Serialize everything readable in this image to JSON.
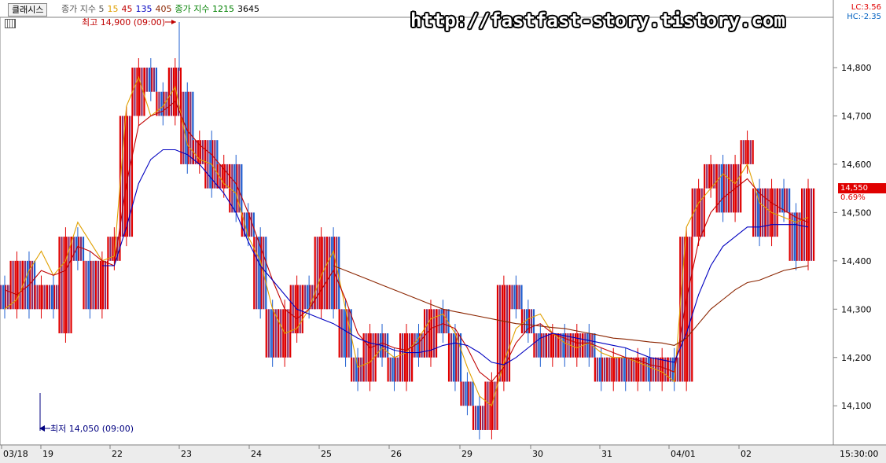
{
  "toolbar": {
    "button_label": "클래시스",
    "legend": [
      {
        "text": "종가 지수 5",
        "color": "#555555"
      },
      {
        "text": "15",
        "color": "#e0a000"
      },
      {
        "text": "45",
        "color": "#c00000"
      },
      {
        "text": "135",
        "color": "#0000c0"
      },
      {
        "text": "405",
        "color": "#8b2500"
      },
      {
        "text": "종가 지수 1215",
        "color": "#008000"
      },
      {
        "text": "3645",
        "color": "#000000"
      }
    ]
  },
  "watermark": "http://fastfast-story.tistory.com",
  "stats": {
    "lc": "LC:3.56",
    "hc": "HC:-2.35",
    "lc_color": "#e00000",
    "hc_color": "#0060c0"
  },
  "current_price": {
    "label": "14,550",
    "change": "0.69%",
    "color": "#e00000"
  },
  "annotations": {
    "high": "최고 14,900 (09:00)",
    "low": "최저 14,050 (09:00)",
    "high_color": "#c00000",
    "low_color": "#000080"
  },
  "time_label": "15:30:00",
  "chart_data": {
    "type": "bar",
    "title": "",
    "ylim": [
      14050,
      14900
    ],
    "y_ticks": [
      {
        "value": 14800,
        "label": "14,800"
      },
      {
        "value": 14700,
        "label": "14,700"
      },
      {
        "value": 14600,
        "label": "14,600"
      },
      {
        "value": 14500,
        "label": "14,500"
      },
      {
        "value": 14400,
        "label": "14,400"
      },
      {
        "value": 14300,
        "label": "14,300"
      },
      {
        "value": 14200,
        "label": "14,200"
      },
      {
        "value": 14100,
        "label": "14,100"
      }
    ],
    "x_labels": [
      "03/18",
      "19",
      "22",
      "23",
      "24",
      "25",
      "26",
      "29",
      "30",
      "31",
      "04/01",
      "02"
    ],
    "grid": false,
    "colors": {
      "up": "#e00000",
      "down": "#1f5fd0",
      "mixed": "#8a2c6a"
    },
    "series": [
      {
        "name": "5",
        "color": "#e0a000",
        "values": [
          14300,
          14320,
          14380,
          14420,
          14370,
          14400,
          14480,
          14440,
          14400,
          14410,
          14720,
          14780,
          14700,
          14720,
          14760,
          14640,
          14610,
          14600,
          14560,
          14540,
          14450,
          14400,
          14300,
          14250,
          14260,
          14300,
          14370,
          14420,
          14300,
          14180,
          14190,
          14220,
          14200,
          14210,
          14240,
          14280,
          14290,
          14250,
          14180,
          14120,
          14100,
          14190,
          14260,
          14280,
          14290,
          14250,
          14230,
          14220,
          14230,
          14210,
          14200,
          14200,
          14190,
          14180,
          14170,
          14150,
          14470,
          14520,
          14550,
          14580,
          14560,
          14600,
          14520,
          14500,
          14490,
          14480,
          14490
        ]
      },
      {
        "name": "45",
        "color": "#c00000",
        "values": [
          14340,
          14330,
          14350,
          14380,
          14370,
          14380,
          14430,
          14420,
          14400,
          14390,
          14560,
          14680,
          14700,
          14710,
          14730,
          14670,
          14640,
          14620,
          14590,
          14560,
          14500,
          14430,
          14360,
          14300,
          14280,
          14300,
          14340,
          14380,
          14320,
          14250,
          14220,
          14230,
          14220,
          14215,
          14230,
          14260,
          14270,
          14260,
          14220,
          14170,
          14150,
          14180,
          14230,
          14260,
          14270,
          14250,
          14240,
          14230,
          14230,
          14220,
          14210,
          14200,
          14195,
          14185,
          14180,
          14170,
          14320,
          14440,
          14500,
          14530,
          14550,
          14570,
          14540,
          14520,
          14505,
          14490,
          14480
        ]
      },
      {
        "name": "135",
        "color": "#0000c0",
        "values": [
          null,
          null,
          null,
          null,
          null,
          null,
          null,
          null,
          14390,
          14390,
          14470,
          14560,
          14610,
          14630,
          14630,
          14620,
          14600,
          14570,
          14540,
          14500,
          14440,
          14390,
          14360,
          14330,
          14300,
          14290,
          14280,
          14270,
          14255,
          14240,
          14230,
          14225,
          14215,
          14210,
          14210,
          14215,
          14225,
          14230,
          14225,
          14210,
          14190,
          14185,
          14200,
          14220,
          14240,
          14250,
          14245,
          14240,
          14235,
          14230,
          14225,
          14220,
          14210,
          14200,
          14195,
          14190,
          14250,
          14330,
          14390,
          14430,
          14450,
          14470,
          14470,
          14475,
          14475,
          14475,
          14470
        ]
      },
      {
        "name": "405",
        "color": "#8b2500",
        "values": [
          null,
          null,
          null,
          null,
          null,
          null,
          null,
          null,
          null,
          null,
          null,
          null,
          null,
          null,
          null,
          null,
          null,
          null,
          null,
          null,
          null,
          null,
          null,
          null,
          null,
          null,
          null,
          14390,
          14380,
          14370,
          14360,
          14350,
          14340,
          14330,
          14320,
          14310,
          14300,
          14295,
          14290,
          14285,
          14280,
          14275,
          14270,
          14268,
          14265,
          14262,
          14260,
          14255,
          14250,
          14245,
          14240,
          14238,
          14235,
          14232,
          14230,
          14225,
          14240,
          14270,
          14300,
          14320,
          14340,
          14355,
          14360,
          14370,
          14380,
          14385,
          14390
        ]
      }
    ],
    "candles": [
      {
        "o": 14350,
        "c": 14300
      },
      {
        "o": 14300,
        "c": 14400
      },
      {
        "o": 14400,
        "c": 14300
      },
      {
        "o": 14300,
        "c": 14350
      },
      {
        "o": 14350,
        "c": 14300
      },
      {
        "o": 14250,
        "c": 14450
      },
      {
        "o": 14450,
        "c": 14400
      },
      {
        "o": 14400,
        "c": 14300
      },
      {
        "o": 14300,
        "c": 14400
      },
      {
        "o": 14400,
        "c": 14450
      },
      {
        "o": 14450,
        "c": 14700
      },
      {
        "o": 14700,
        "c": 14800
      },
      {
        "o": 14800,
        "c": 14750
      },
      {
        "o": 14750,
        "c": 14700
      },
      {
        "o": 14700,
        "c": 14800
      },
      {
        "o": 14750,
        "c": 14600
      },
      {
        "o": 14600,
        "c": 14650
      },
      {
        "o": 14650,
        "c": 14550
      },
      {
        "o": 14550,
        "c": 14600
      },
      {
        "o": 14600,
        "c": 14500
      },
      {
        "o": 14500,
        "c": 14450
      },
      {
        "o": 14450,
        "c": 14300
      },
      {
        "o": 14300,
        "c": 14200
      },
      {
        "o": 14200,
        "c": 14300
      },
      {
        "o": 14250,
        "c": 14350
      },
      {
        "o": 14350,
        "c": 14300
      },
      {
        "o": 14300,
        "c": 14450
      },
      {
        "o": 14450,
        "c": 14300
      },
      {
        "o": 14300,
        "c": 14200
      },
      {
        "o": 14200,
        "c": 14150
      },
      {
        "o": 14150,
        "c": 14250
      },
      {
        "o": 14250,
        "c": 14200
      },
      {
        "o": 14200,
        "c": 14150
      },
      {
        "o": 14150,
        "c": 14250
      },
      {
        "o": 14250,
        "c": 14200
      },
      {
        "o": 14200,
        "c": 14300
      },
      {
        "o": 14300,
        "c": 14250
      },
      {
        "o": 14250,
        "c": 14150
      },
      {
        "o": 14150,
        "c": 14100
      },
      {
        "o": 14100,
        "c": 14050
      },
      {
        "o": 14050,
        "c": 14150
      },
      {
        "o": 14150,
        "c": 14350
      },
      {
        "o": 14350,
        "c": 14300
      },
      {
        "o": 14300,
        "c": 14250
      },
      {
        "o": 14250,
        "c": 14200
      },
      {
        "o": 14200,
        "c": 14250
      },
      {
        "o": 14250,
        "c": 14200
      },
      {
        "o": 14200,
        "c": 14250
      },
      {
        "o": 14250,
        "c": 14200
      },
      {
        "o": 14200,
        "c": 14150
      },
      {
        "o": 14150,
        "c": 14200
      },
      {
        "o": 14200,
        "c": 14150
      },
      {
        "o": 14150,
        "c": 14200
      },
      {
        "o": 14200,
        "c": 14150
      },
      {
        "o": 14150,
        "c": 14200
      },
      {
        "o": 14200,
        "c": 14150
      },
      {
        "o": 14150,
        "c": 14450
      },
      {
        "o": 14450,
        "c": 14550
      },
      {
        "o": 14550,
        "c": 14600
      },
      {
        "o": 14600,
        "c": 14500
      },
      {
        "o": 14500,
        "c": 14600
      },
      {
        "o": 14600,
        "c": 14650
      },
      {
        "o": 14550,
        "c": 14450
      },
      {
        "o": 14450,
        "c": 14550
      },
      {
        "o": 14550,
        "c": 14500
      },
      {
        "o": 14500,
        "c": 14400
      },
      {
        "o": 14400,
        "c": 14550
      }
    ]
  }
}
